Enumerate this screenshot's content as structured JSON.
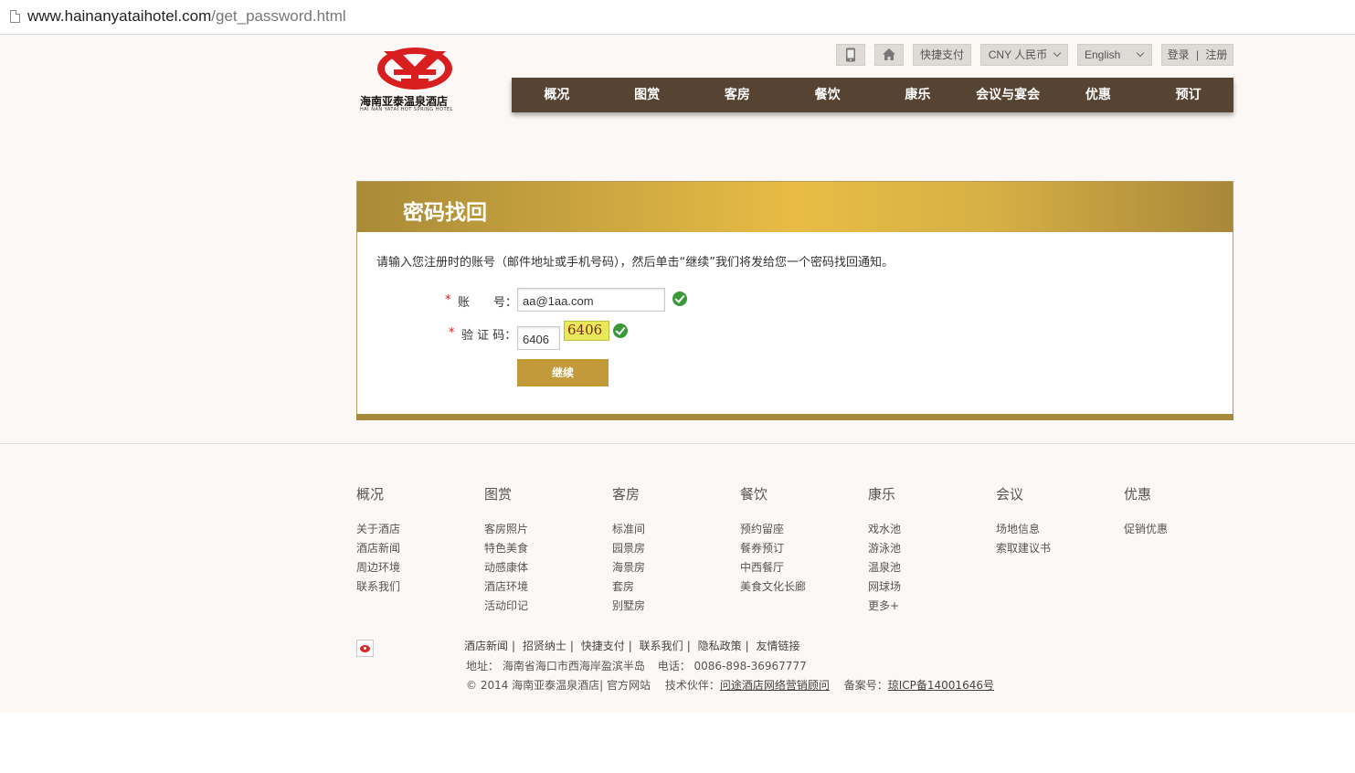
{
  "browser": {
    "url_domain": "www.hainanyataihotel.com",
    "url_path": "/get_password.html"
  },
  "logo": {
    "name_cn": "海南亚泰温泉酒店",
    "name_en": "HAI NAN YATAI HOT SPRING HOTEL"
  },
  "topbar": {
    "quick_pay": "快捷支付",
    "currency": "CNY 人民币",
    "language": "English",
    "login": "登录",
    "register": "注册",
    "divider": "|"
  },
  "nav": [
    "概况",
    "图赏",
    "客房",
    "餐饮",
    "康乐",
    "会议与宴会",
    "优惠",
    "预订"
  ],
  "form": {
    "title": "密码找回",
    "intro": "请输入您注册时的账号（邮件地址或手机号码），然后单击“继续”我们将发给您一个密码找回通知。",
    "required_mark": "*",
    "account_label": "账　　号：",
    "account_value": "aa@1aa.com",
    "captcha_label": "验 证 码：",
    "captcha_value": "6406",
    "captcha_image_text": "6406",
    "submit": "继续"
  },
  "footer": {
    "columns": [
      {
        "title": "概况",
        "links": [
          "关于酒店",
          "酒店新闻",
          "周边环境",
          "联系我们"
        ]
      },
      {
        "title": "图赏",
        "links": [
          "客房照片",
          "特色美食",
          "动感康体",
          "酒店环境",
          "活动印记"
        ]
      },
      {
        "title": "客房",
        "links": [
          "标准间",
          "园景房",
          "海景房",
          "套房",
          "别墅房"
        ]
      },
      {
        "title": "餐饮",
        "links": [
          "预约留座",
          "餐券预订",
          "中西餐厅",
          "美食文化长廊"
        ]
      },
      {
        "title": "康乐",
        "links": [
          "戏水池",
          "游泳池",
          "温泉池",
          "网球场",
          "更多+"
        ]
      },
      {
        "title": "会议",
        "links": [
          "场地信息",
          "索取建议书"
        ]
      },
      {
        "title": "优惠",
        "links": [
          "促销优惠"
        ]
      }
    ],
    "bottom_links": [
      "酒店新闻",
      "招贤纳士",
      "快捷支付",
      "联系我们",
      "隐私政策",
      "友情链接"
    ],
    "address_label": "地址：",
    "address": "海南省海口市西海岸盈滨半岛",
    "phone_label": "电话：",
    "phone": "0086-898-36967777",
    "copyright": "© 2014 海南亚泰温泉酒店| 官方网站",
    "tech_label": "技术伙伴：",
    "tech_partner": "问途酒店网络营销顾问",
    "icp_label": "备案号：",
    "icp": "琼ICP备14001646号"
  },
  "colors": {
    "nav_bg": "#564332",
    "gold": "#c29a3a",
    "page_bg": "#fcf8f5",
    "logo_red": "#d81e1e"
  },
  "icons": [
    "page-icon",
    "mobile-icon",
    "home-icon",
    "check-icon",
    "chevron-down-icon",
    "weibo-icon"
  ]
}
